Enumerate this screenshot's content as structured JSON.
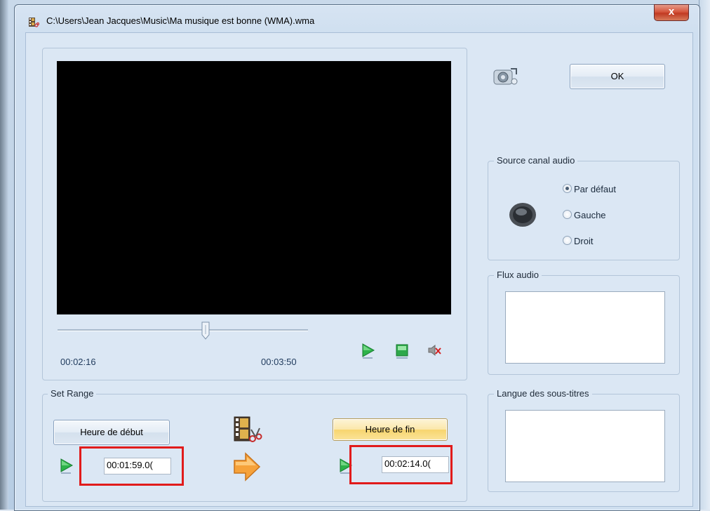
{
  "window": {
    "title": "C:\\Users\\Jean Jacques\\Music\\Ma musique est bonne (WMA).wma",
    "close_label": "x"
  },
  "player": {
    "current_time": "00:02:16",
    "total_time": "00:03:50",
    "position_fraction": 0.59
  },
  "controls": {
    "play_icon": "play-icon",
    "stop_icon": "stop-icon",
    "mute_icon": "mute-icon"
  },
  "ok_label": "OK",
  "audio_source": {
    "title": "Source canal audio",
    "options": [
      {
        "label": "Par défaut",
        "checked": true
      },
      {
        "label": "Gauche",
        "checked": false
      },
      {
        "label": "Droit",
        "checked": false
      }
    ]
  },
  "audio_stream": {
    "title": "Flux audio"
  },
  "subtitles": {
    "title": "Langue des sous-titres"
  },
  "set_range": {
    "title": "Set Range",
    "start_button": "Heure de début",
    "end_button": "Heure de fin",
    "start_value": "00:01:59.0(",
    "end_value": "00:02:14.0("
  },
  "colors": {
    "accent_highlight": "#e11b1b",
    "video_bg": "#000000",
    "hot_button": "#f7d56e"
  }
}
